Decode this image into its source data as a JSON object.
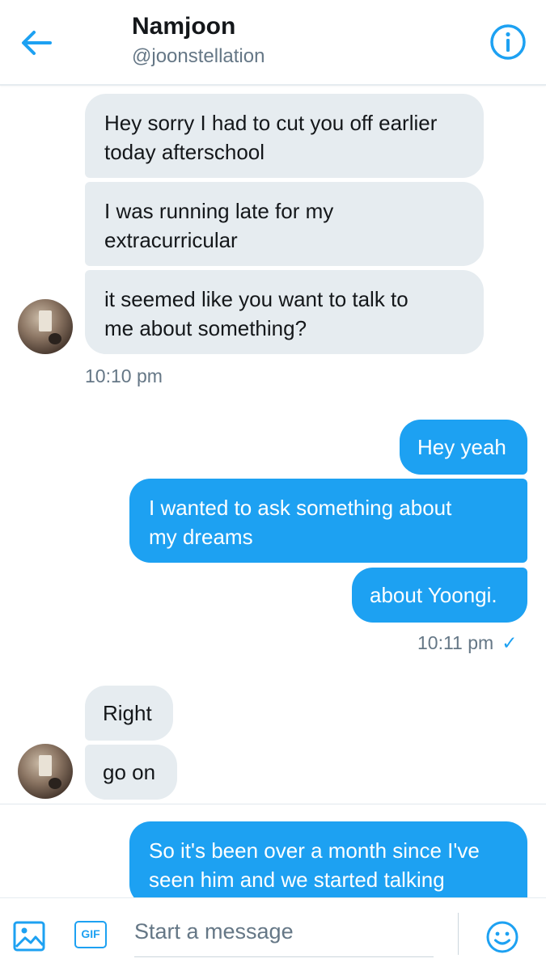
{
  "header": {
    "name": "Namjoon",
    "handle": "@joonstellation",
    "back_icon": "arrow-left-icon",
    "info_icon": "info-circle-icon"
  },
  "messages": {
    "group1": [
      "Hey sorry I had to cut you off earlier\ntoday afterschool",
      "I was running late for my\nextracurricular",
      "it seemed like you want to talk to\nme about something?"
    ],
    "group1_time": "10:10 pm",
    "group2": [
      "Hey yeah",
      "I wanted to ask something about\nmy dreams",
      "about Yoongi."
    ],
    "group2_time": "10:11 pm",
    "group2_read_icon": "checkmark-icon",
    "group3": [
      "Right",
      "go on"
    ],
    "group4": [
      "So it's been over a month since I've\nseen him and we started talking"
    ]
  },
  "composer": {
    "placeholder": "Start a message",
    "gif_label": "GIF",
    "image_icon": "image-icon",
    "emoji_icon": "smiley-icon"
  },
  "colors": {
    "accent": "#1da1f2",
    "received_bubble": "#e6ecf0",
    "secondary_text": "#657786"
  }
}
